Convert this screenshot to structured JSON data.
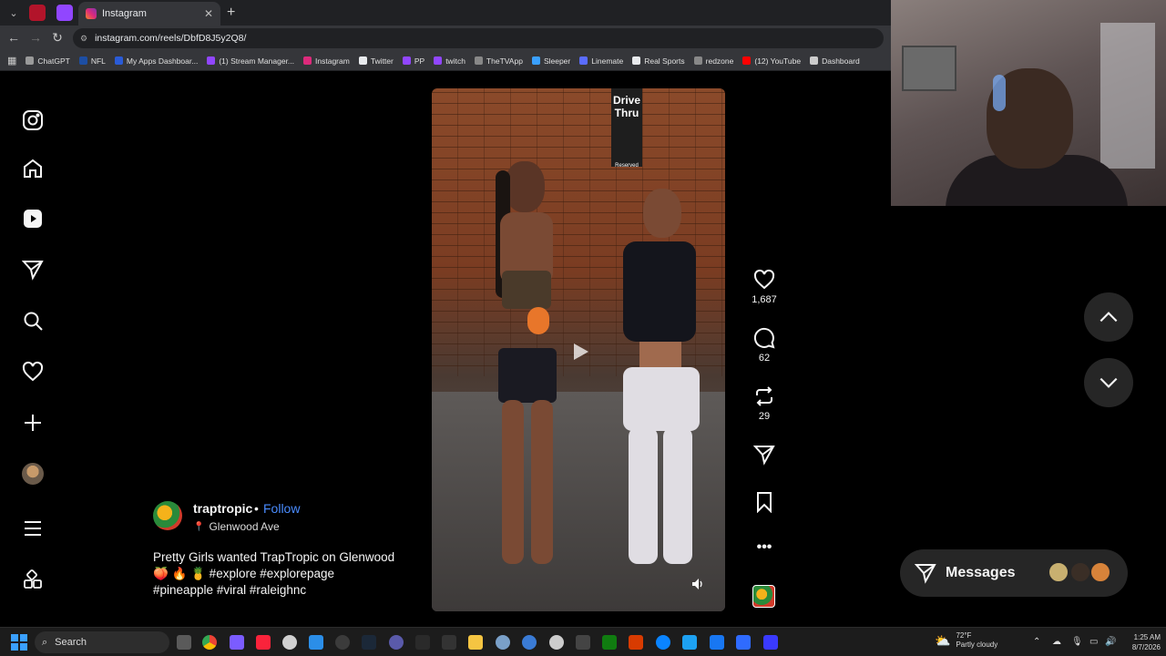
{
  "browser": {
    "active_tab_title": "Instagram",
    "new_tab": "+",
    "url": "instagram.com/reels/DbfD8J5y2Q8/",
    "bookmarks": [
      {
        "label": "ChatGPT",
        "color": "#9a9a9a"
      },
      {
        "label": "NFL",
        "color": "#1d4ea3"
      },
      {
        "label": "My Apps Dashboar...",
        "color": "#2a5bd7"
      },
      {
        "label": "(1) Stream Manager...",
        "color": "#9146ff"
      },
      {
        "label": "Instagram",
        "color": "#dd2a7b"
      },
      {
        "label": "Twitter",
        "color": "#e8eaed"
      },
      {
        "label": "PP",
        "color": "#9146ff"
      },
      {
        "label": "twitch",
        "color": "#9146ff"
      },
      {
        "label": "TheTVApp",
        "color": "#888888"
      },
      {
        "label": "Sleeper",
        "color": "#3aa0ff"
      },
      {
        "label": "Linemate",
        "color": "#5a6cff"
      },
      {
        "label": "Real Sports",
        "color": "#e8eaed"
      },
      {
        "label": "redzone",
        "color": "#888888"
      },
      {
        "label": "(12) YouTube",
        "color": "#ff0000"
      },
      {
        "label": "Dashboard",
        "color": "#cccccc"
      }
    ]
  },
  "post": {
    "username": "traptropic",
    "separator": "•",
    "follow_label": "Follow",
    "location": "Glenwood Ave",
    "caption_line1": "Pretty Girls wanted TrapTropic on Glenwood",
    "caption_line2": "🍑 🔥 🍍 #explore #explorepage",
    "caption_line3": "#pineapple #viral #raleighnc",
    "sign_text_line1": "Drive",
    "sign_text_line2": "Thru",
    "sign_small": "Reserved"
  },
  "actions": {
    "likes": "1,687",
    "comments": "62",
    "reposts": "29"
  },
  "messages": {
    "label": "Messages"
  },
  "taskbar": {
    "search_label": "Search",
    "weather_temp": "72°F",
    "weather_desc": "Partly cloudy",
    "time": "1:25 AM",
    "date": "8/7/2026"
  },
  "colors": {
    "follow": "#4a8cff",
    "background": "#000000",
    "panel": "#262626"
  }
}
